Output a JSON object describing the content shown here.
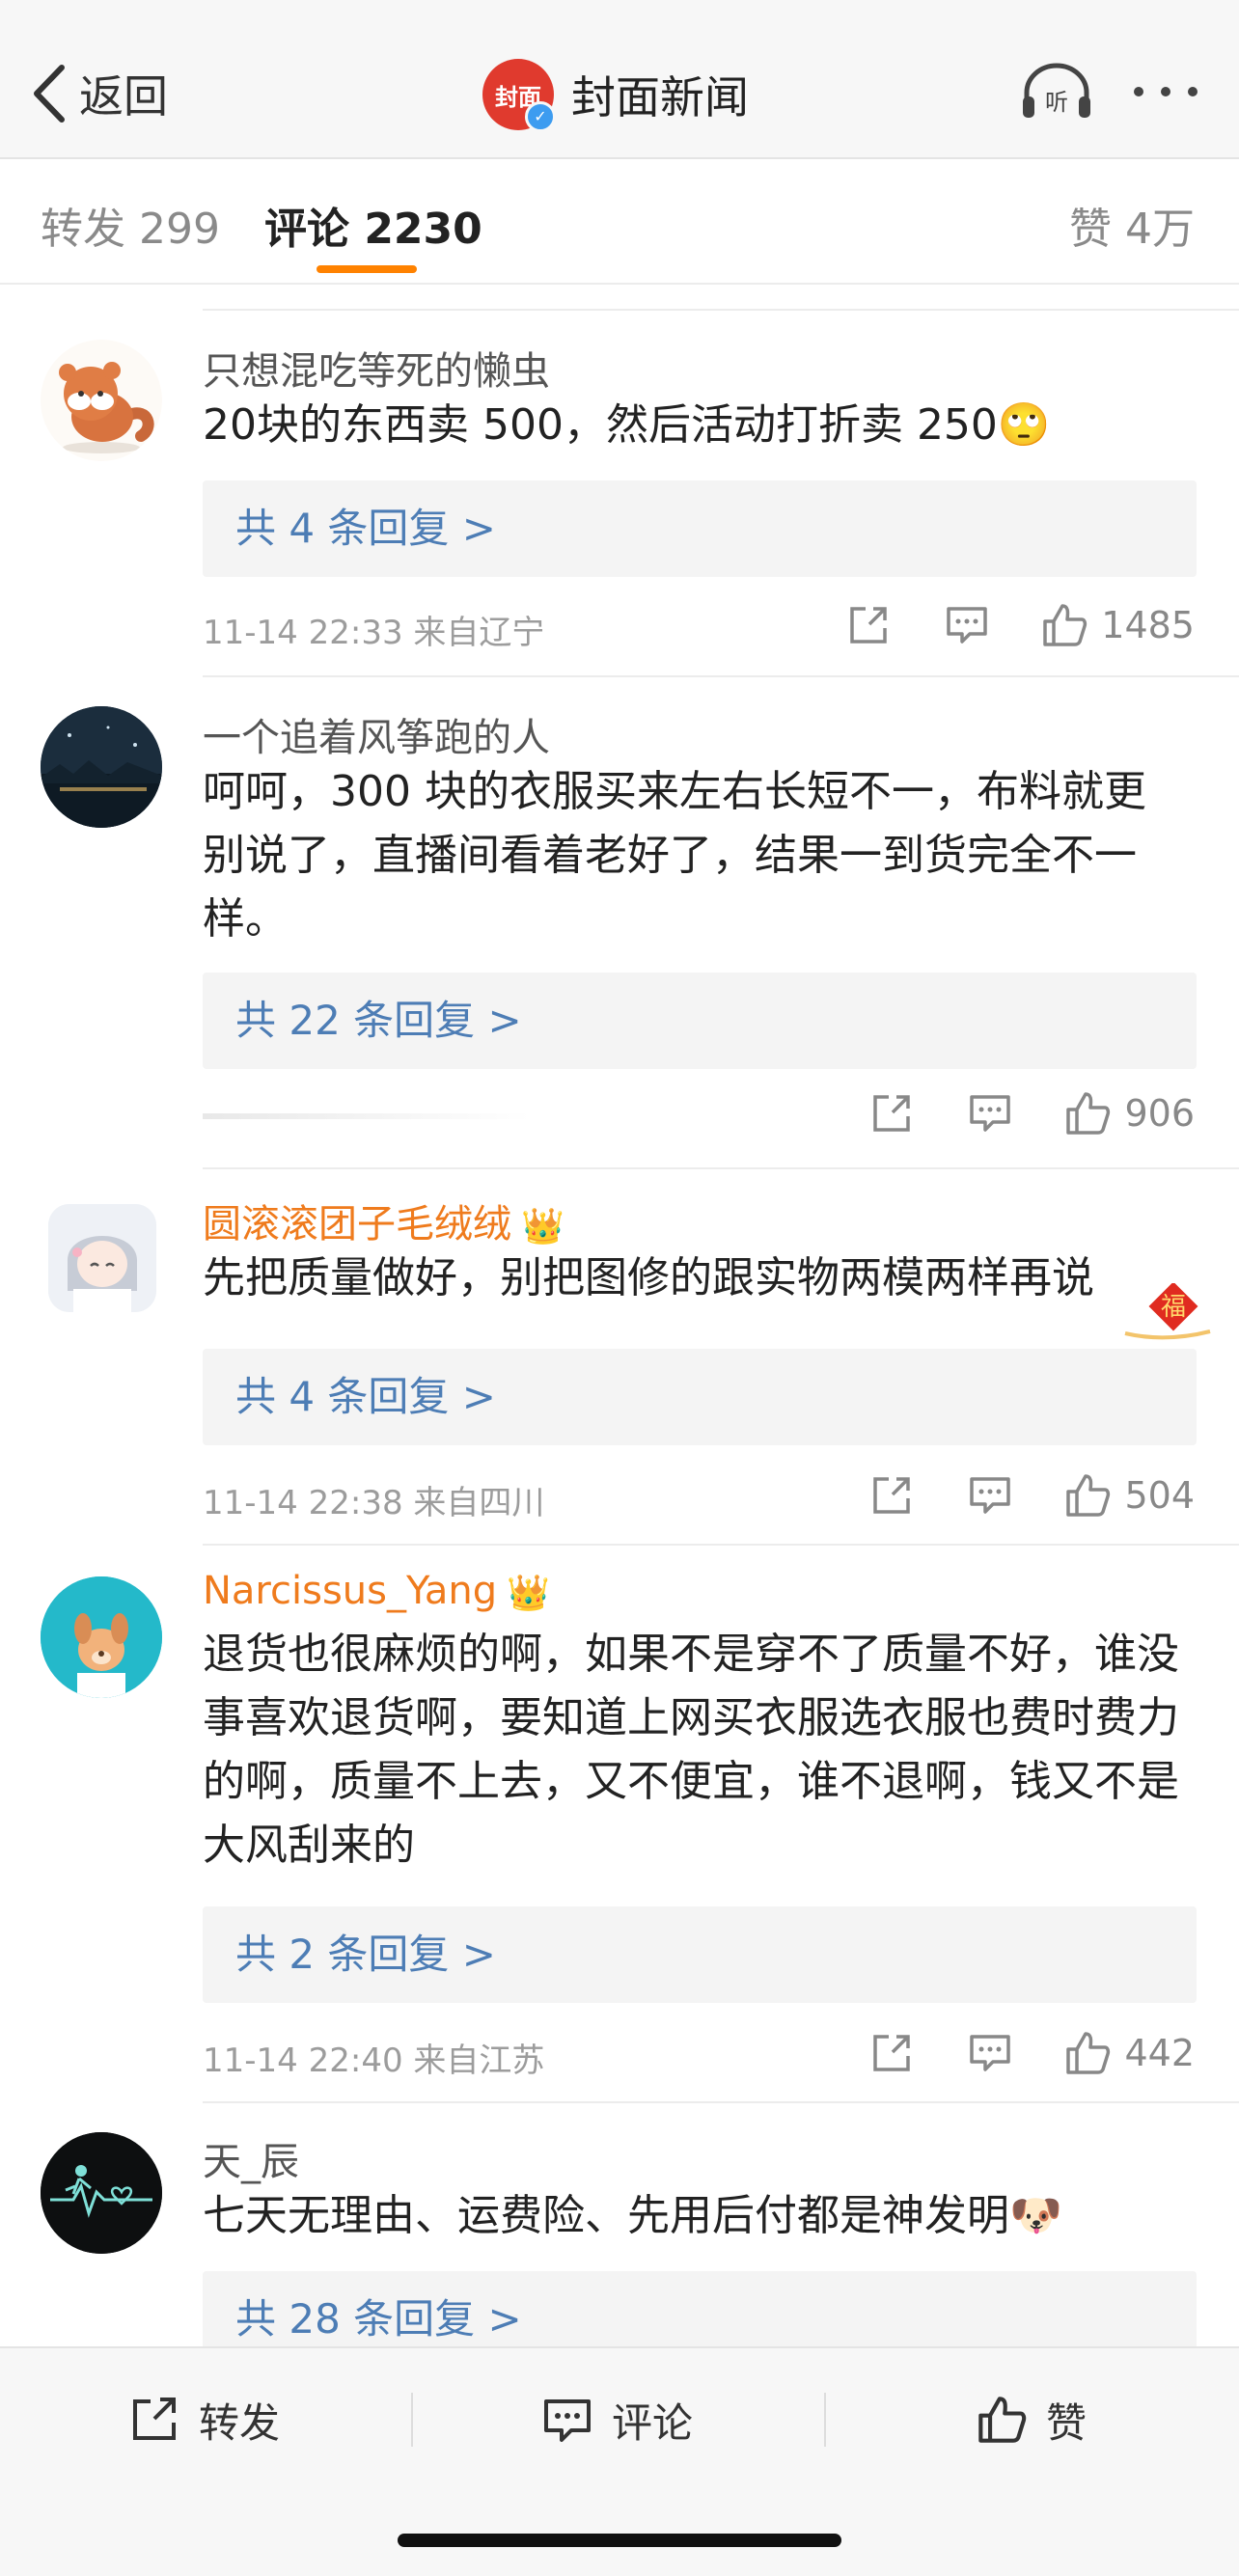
{
  "nav": {
    "back_label": "返回",
    "brand_logo_text": "封面",
    "brand_name": "封面新闻",
    "listen_icon": "headphones-listen-icon",
    "more_icon": "more-dots-icon"
  },
  "tabs": {
    "forward": "转发 299",
    "comments": "评论 2230",
    "likes": "赞 4万"
  },
  "comments": [
    {
      "username": "只想混吃等死的懒虫",
      "text": "20块的东西卖 500，然后活动打折卖 250🙄",
      "replies": "共 4 条回复 >",
      "meta": "11-14 22:33  来自辽宁",
      "likes": "1485"
    },
    {
      "username": "一个追着风筝跑的人",
      "text": "呵呵，300 块的衣服买来左右长短不一，布料就更别说了，直播间看着老好了，结果一到货完全不一样。",
      "replies": "共 22 条回复 >",
      "meta": "",
      "likes": "906"
    },
    {
      "username": "圆滚滚团子毛绒绒",
      "text": "先把质量做好，别把图修的跟实物两模两样再说",
      "replies": "共 4 条回复 >",
      "meta": "11-14 22:38  来自四川",
      "likes": "504"
    },
    {
      "username": "Narcissus_Yang",
      "text": "退货也很麻烦的啊，如果不是穿不了质量不好，谁没事喜欢退货啊，要知道上网买衣服选衣服也费时费力的啊，质量不上去，又不便宜，谁不退啊，钱又不是大风刮来的",
      "replies": "共 2 条回复 >",
      "meta": "11-14 22:40  来自江苏",
      "likes": "442"
    },
    {
      "username": "天_辰",
      "text": "七天无理由、运费险、先用后付都是神发明🐶",
      "replies": "共 28 条回复 >"
    }
  ],
  "badges": {
    "fu": "福",
    "crown": "👑"
  },
  "bottom_bar": {
    "forward": "转发",
    "comment": "评论",
    "like": "赞"
  },
  "colors": {
    "accent": "#ff8200",
    "link": "#4d7db5",
    "vip_name": "#ef7b1d"
  }
}
